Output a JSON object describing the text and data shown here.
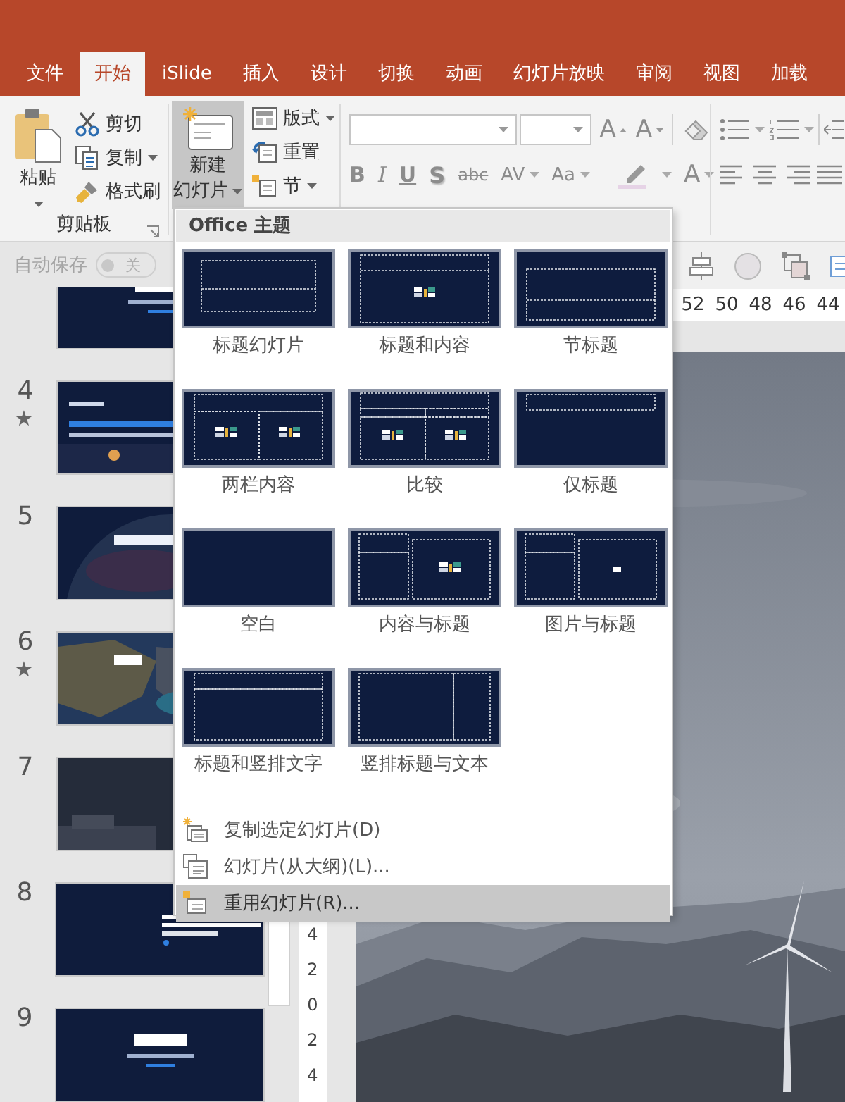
{
  "tabs": [
    {
      "label": "文件",
      "selected": false
    },
    {
      "label": "开始",
      "selected": true
    },
    {
      "label": "iSlide",
      "selected": false
    },
    {
      "label": "插入",
      "selected": false
    },
    {
      "label": "设计",
      "selected": false
    },
    {
      "label": "切换",
      "selected": false
    },
    {
      "label": "动画",
      "selected": false
    },
    {
      "label": "幻灯片放映",
      "selected": false
    },
    {
      "label": "审阅",
      "selected": false
    },
    {
      "label": "视图",
      "selected": false
    },
    {
      "label": "加载",
      "selected": false
    }
  ],
  "ribbon": {
    "clipboard": {
      "paste": "粘贴",
      "cut": "剪切",
      "copy": "复制",
      "format_painter": "格式刷",
      "group_label": "剪贴板"
    },
    "slides": {
      "new_slide": {
        "lines": [
          "新建",
          "幻灯片"
        ],
        "pressed": true
      },
      "layout": "版式",
      "reset": "重置",
      "section": "节"
    },
    "font": {
      "grow": "A",
      "shrink": "A",
      "bold": "B",
      "italic": "I",
      "underline": "U",
      "shadow": "S",
      "strikethrough": "abc",
      "spacing": "AV",
      "case": "Aa",
      "font_color": "A"
    }
  },
  "autosave": {
    "label": "自动保存",
    "state": "关",
    "on": false
  },
  "slides": [
    {
      "kind": "cut"
    },
    {
      "kind": "full",
      "number": "4",
      "marker": "★"
    },
    {
      "kind": "full",
      "number": "5"
    },
    {
      "kind": "full",
      "number": "6",
      "marker": "★"
    },
    {
      "kind": "full",
      "number": "7"
    },
    {
      "kind": "full",
      "number": "8"
    },
    {
      "kind": "full",
      "number": "9"
    }
  ],
  "ruler_h": [
    "52",
    "50",
    "48",
    "46",
    "44"
  ],
  "ruler_v": [
    "4",
    "2",
    "0",
    "2",
    "4"
  ],
  "layout_menu": {
    "header": "Office 主题",
    "layouts": [
      {
        "label": "标题幻灯片",
        "kind": "title"
      },
      {
        "label": "标题和内容",
        "kind": "title-content"
      },
      {
        "label": "节标题",
        "kind": "section"
      },
      {
        "label": "两栏内容",
        "kind": "two-content"
      },
      {
        "label": "比较",
        "kind": "comparison"
      },
      {
        "label": "仅标题",
        "kind": "title-only"
      },
      {
        "label": "空白",
        "kind": "blank"
      },
      {
        "label": "内容与标题",
        "kind": "content-caption"
      },
      {
        "label": "图片与标题",
        "kind": "picture-caption"
      },
      {
        "label": "标题和竖排文字",
        "kind": "title-vertical"
      },
      {
        "label": "竖排标题与文本",
        "kind": "vertical-title"
      }
    ],
    "items": [
      {
        "label": "复制选定幻灯片(D)",
        "kind": "duplicate",
        "selected": false
      },
      {
        "label": "幻灯片(从大纲)(L)...",
        "kind": "outline",
        "selected": false
      },
      {
        "label": "重用幻灯片(R)...",
        "kind": "reuse",
        "selected": true
      }
    ]
  }
}
